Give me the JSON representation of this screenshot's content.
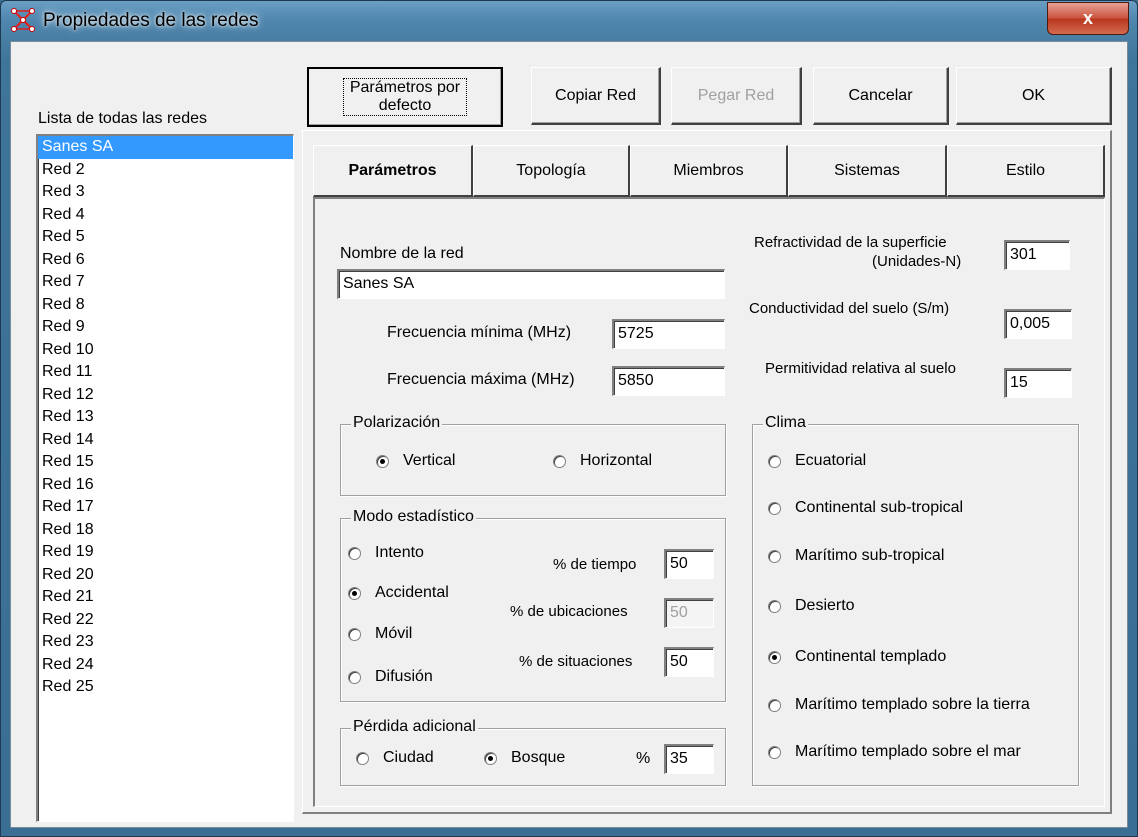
{
  "window": {
    "title": "Propiedades de las redes",
    "close_glyph": "x"
  },
  "list": {
    "label": "Lista de todas las redes",
    "items": [
      "Sanes SA",
      "Red  2",
      "Red  3",
      "Red  4",
      "Red  5",
      "Red  6",
      "Red  7",
      "Red  8",
      "Red  9",
      "Red 10",
      "Red 11",
      "Red 12",
      "Red 13",
      "Red 14",
      "Red 15",
      "Red 16",
      "Red 17",
      "Red 18",
      "Red 19",
      "Red 20",
      "Red 21",
      "Red 22",
      "Red 23",
      "Red 24",
      "Red 25"
    ],
    "selected": "Sanes SA"
  },
  "buttons": {
    "defaults_line1": "Parámetros por",
    "defaults_line2": "defecto",
    "copy": "Copiar Red",
    "paste": "Pegar Red",
    "cancel": "Cancelar",
    "ok": "OK"
  },
  "tabs": [
    "Parámetros",
    "Topología",
    "Miembros",
    "Sistemas",
    "Estilo"
  ],
  "params": {
    "name_label": "Nombre de la red",
    "name_value": "Sanes SA",
    "fmin_label": "Frecuencia mínima (MHz)",
    "fmin_value": "5725",
    "fmax_label": "Frecuencia máxima (MHz)",
    "fmax_value": "5850",
    "refr_label_1": "Refractividad de la superficie",
    "refr_label_2": "(Unidades-N)",
    "refr_value": "301",
    "cond_label": "Conductividad del suelo (S/m)",
    "cond_value": "0,005",
    "perm_label": "Permitividad relativa al suelo",
    "perm_value": "15"
  },
  "polarization": {
    "title": "Polarización",
    "vertical": "Vertical",
    "horizontal": "Horizontal",
    "selected": "Vertical"
  },
  "stat_mode": {
    "title": "Modo estadístico",
    "options": [
      "Intento",
      "Accidental",
      "Móvil",
      "Difusión"
    ],
    "selected": "Accidental",
    "time_label": "% de tiempo",
    "time_value": "50",
    "loc_label": "% de ubicaciones",
    "loc_value": "50",
    "sit_label": "% de situaciones",
    "sit_value": "50"
  },
  "extra_loss": {
    "title": "Pérdida adicional",
    "city": "Ciudad",
    "forest": "Bosque",
    "selected": "Bosque",
    "pct_label": "%",
    "pct_value": "35"
  },
  "climate": {
    "title": "Clima",
    "options": [
      "Ecuatorial",
      "Continental sub-tropical",
      "Marítimo sub-tropical",
      "Desierto",
      "Continental templado",
      "Marítimo templado sobre la tierra",
      "Marítimo templado sobre el mar"
    ],
    "selected": "Continental templado"
  }
}
